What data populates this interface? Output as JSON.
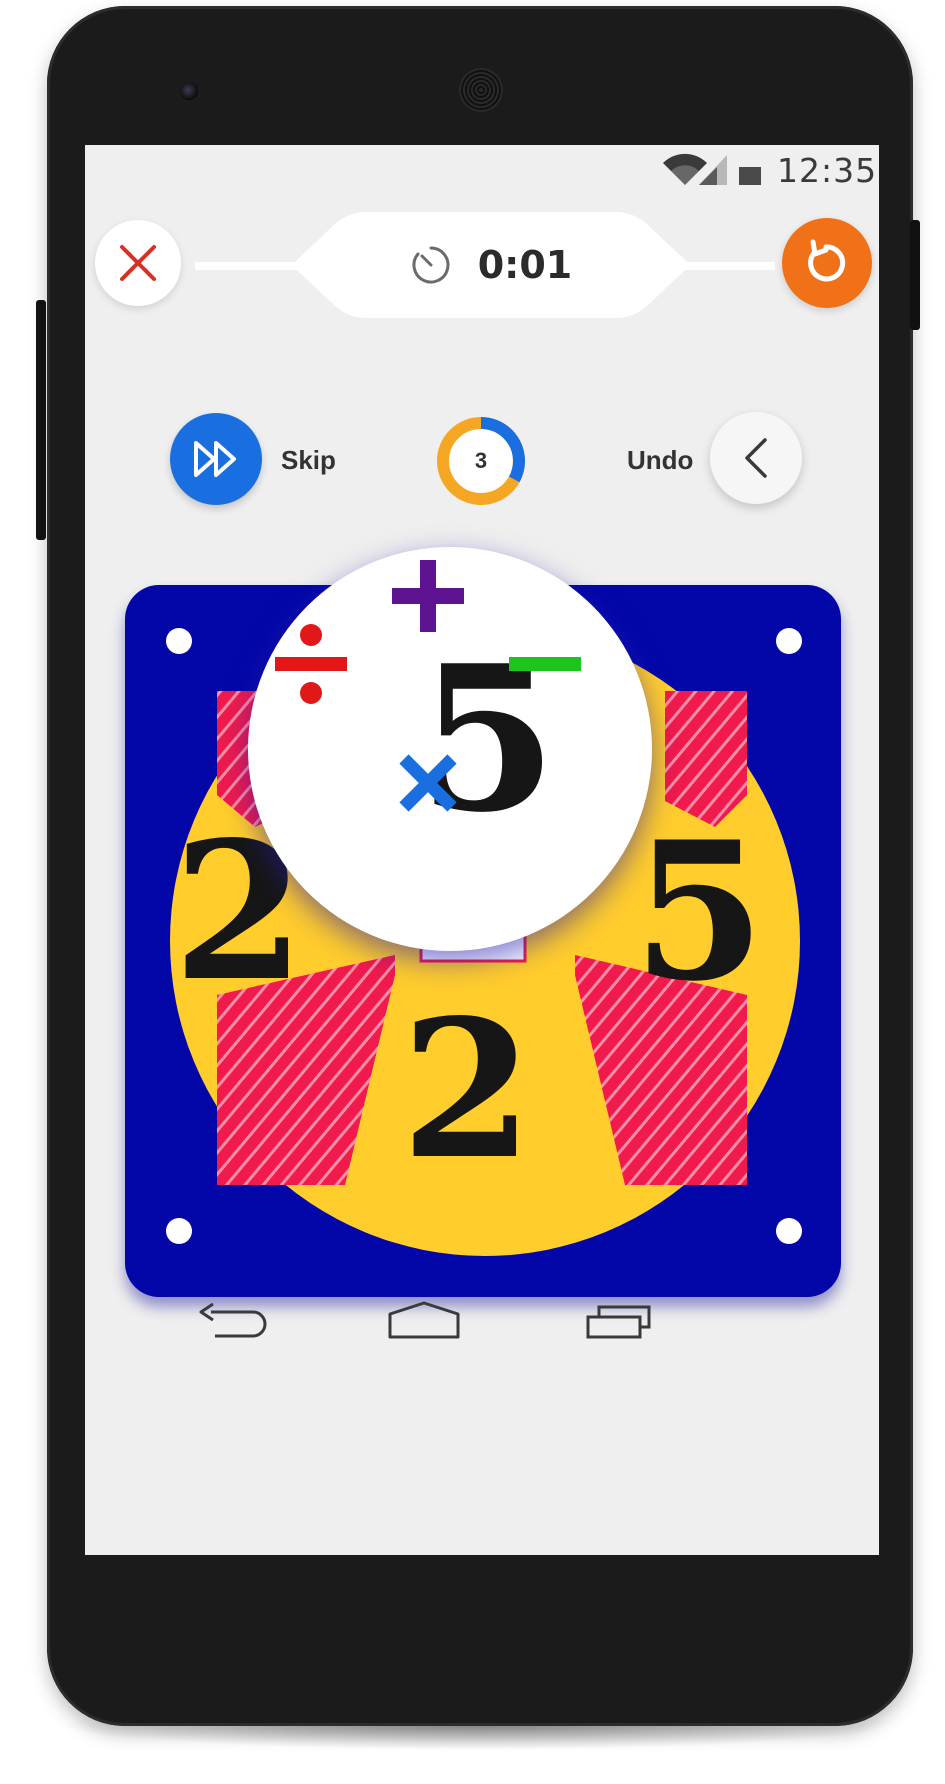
{
  "status_bar": {
    "time": "12:35",
    "icons": [
      "wifi-icon",
      "signal-icon",
      "battery-icon"
    ]
  },
  "top_bar": {
    "close_icon": "close-icon",
    "timer_icon": "stopwatch-icon",
    "timer_value": "0:01",
    "restart_icon": "restart-icon"
  },
  "actions": {
    "skip_label": "Skip",
    "skip_icon": "fast-forward-icon",
    "remaining_count": "3",
    "remaining_progress": 0.33,
    "undo_label": "Undo",
    "undo_icon": "chevron-left-icon"
  },
  "board": {
    "center_number": "5",
    "left_number": "2",
    "right_number": "5",
    "bottom_number": "2",
    "operators": {
      "top": "+",
      "left": "÷",
      "right": "−",
      "bottom": "×"
    }
  },
  "nav_bar": [
    "back-icon",
    "home-icon",
    "recents-icon"
  ],
  "colors": {
    "board": "#0407a8",
    "circle": "#ffcd2c",
    "rays": "#f01a4c",
    "plus": "#5e1490",
    "divide": "#e01818",
    "minus": "#1cc41c",
    "times": "#1a6fe0",
    "skip": "#1a6fe0",
    "restart": "#f07117",
    "close": "#d93025",
    "counter_ring_blue": "#1a6fe0",
    "counter_ring_orange": "#f5a623"
  }
}
